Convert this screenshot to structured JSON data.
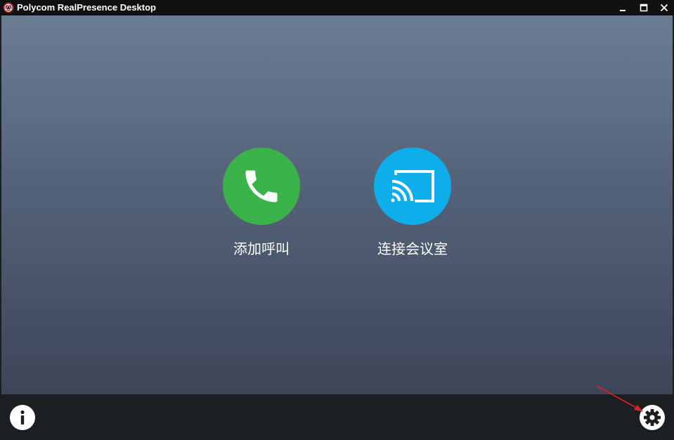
{
  "window": {
    "title": "Polycom RealPresence Desktop",
    "controls": [
      "minimize-icon",
      "maximize-icon",
      "close-icon"
    ]
  },
  "actions": [
    {
      "label": "添加呼叫",
      "icon": "phone-icon",
      "color": "#3ab44a"
    },
    {
      "label": "连接会议室",
      "icon": "screen-cast-icon",
      "color": "#0eaeea"
    }
  ],
  "footer": {
    "info_icon": "info-icon",
    "settings_icon": "gear-icon"
  },
  "annotation": {
    "type": "red-arrow",
    "color": "#e02020",
    "points_to": "settings-button"
  }
}
